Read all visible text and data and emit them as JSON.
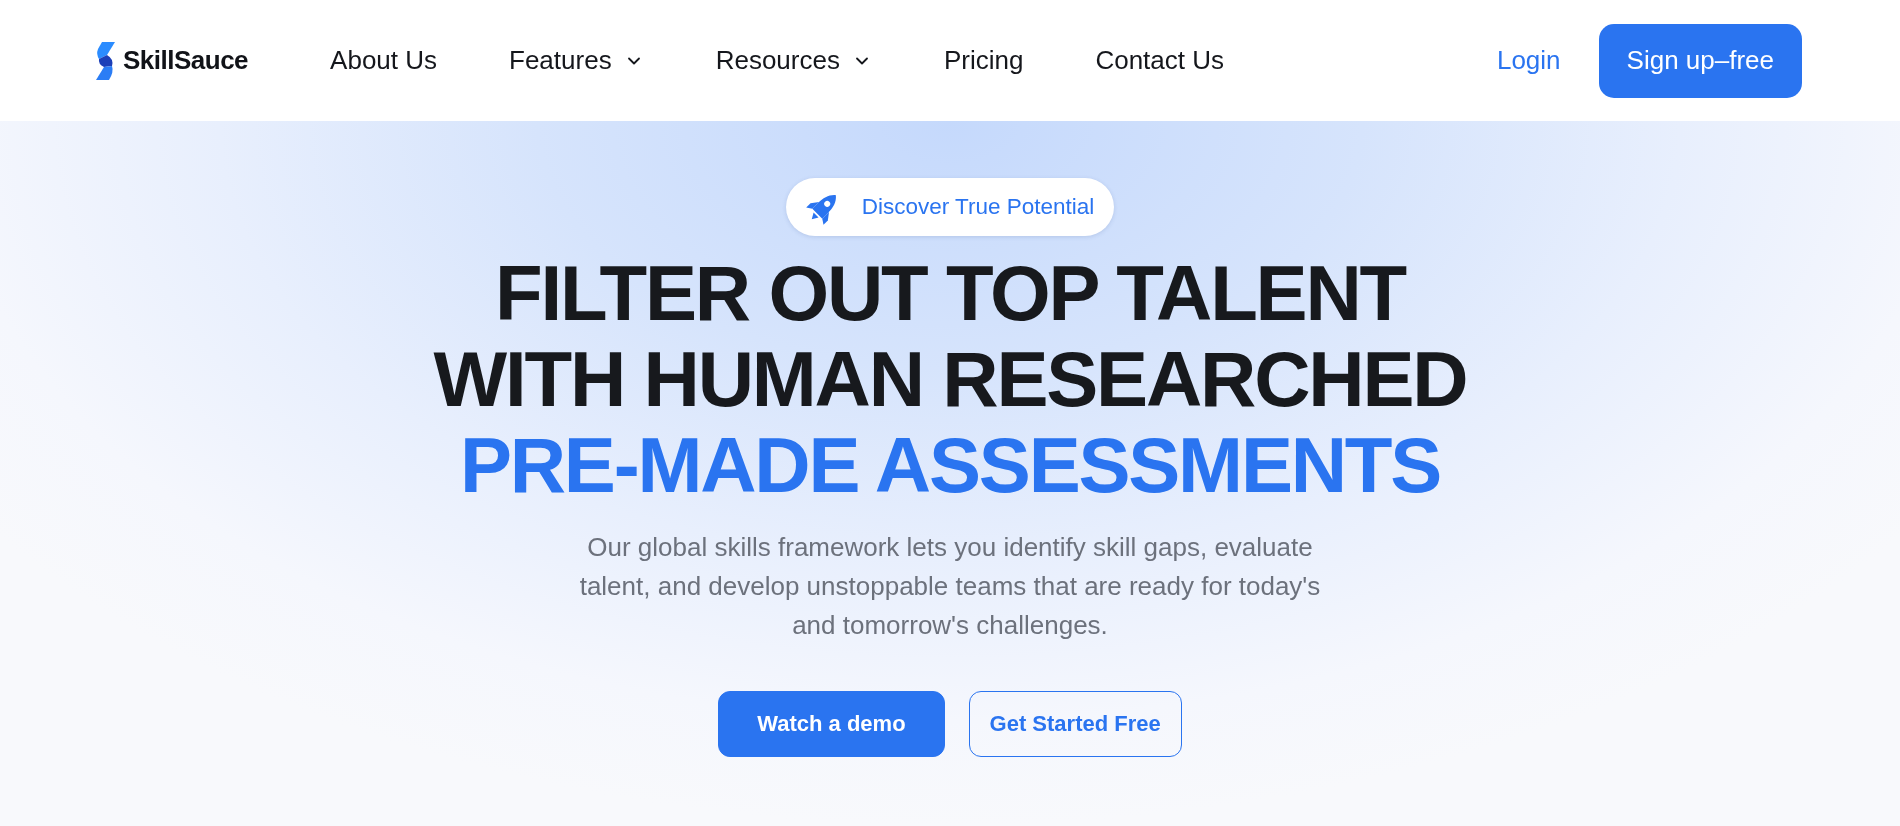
{
  "header": {
    "logo": {
      "name": "SkillSauce"
    },
    "nav": [
      {
        "label": "About Us",
        "dropdown": false
      },
      {
        "label": "Features",
        "dropdown": true
      },
      {
        "label": "Resources",
        "dropdown": true
      },
      {
        "label": "Pricing",
        "dropdown": false
      },
      {
        "label": "Contact Us",
        "dropdown": false
      }
    ],
    "login": "Login",
    "signup": "Sign up–free"
  },
  "hero": {
    "badge": "Discover True Potential",
    "headline": [
      {
        "text": "FILTER OUT TOP TALENT",
        "accent": false
      },
      {
        "text": "WITH HUMAN RESEARCHED",
        "accent": false
      },
      {
        "text": "PRE-MADE ASSESSMENTS",
        "accent": true
      }
    ],
    "description": "Our global skills framework lets you identify skill gaps, evaluate talent, and develop unstoppable teams that are ready for today's and tomorrow's challenges.",
    "buttons": [
      {
        "label": "Watch a demo",
        "kind": "primary"
      },
      {
        "label": "Get Started Free",
        "kind": "outline"
      }
    ]
  }
}
